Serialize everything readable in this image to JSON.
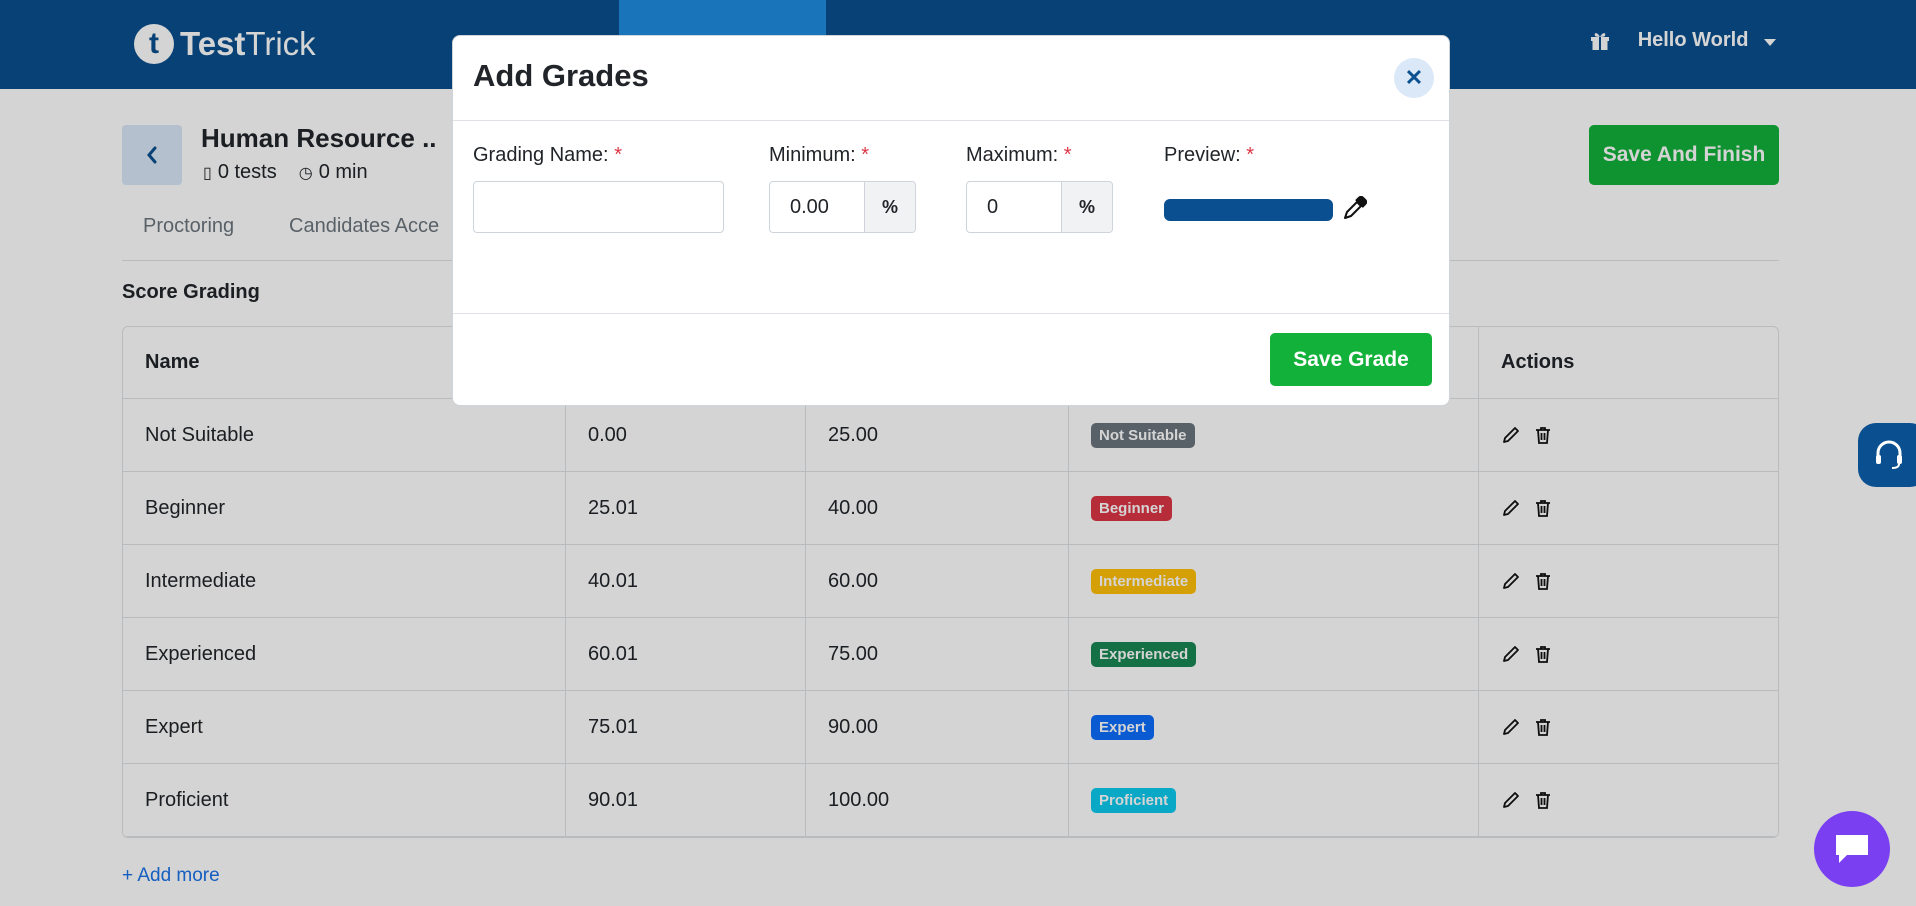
{
  "header": {
    "logo_letter": "t",
    "logo_bold": "Test",
    "logo_regular": "Trick",
    "user_name": "Hello World"
  },
  "test": {
    "title": "Human Resource ..",
    "tests": "0 tests",
    "duration": "0 min",
    "save_finish_label": "Save And Finish"
  },
  "tabs": [
    "Proctoring",
    "Candidates Acce"
  ],
  "section_title": "Score Grading",
  "table": {
    "headers": [
      "Name",
      "",
      "",
      "",
      "Actions"
    ],
    "rows": [
      {
        "name": "Not Suitable",
        "min": "0.00",
        "max": "25.00",
        "badge": "Not Suitable",
        "color": "#6c757d"
      },
      {
        "name": "Beginner",
        "min": "25.01",
        "max": "40.00",
        "badge": "Beginner",
        "color": "#dc3545"
      },
      {
        "name": "Intermediate",
        "min": "40.01",
        "max": "60.00",
        "badge": "Intermediate",
        "color": "#ffc107"
      },
      {
        "name": "Experienced",
        "min": "60.01",
        "max": "75.00",
        "badge": "Experienced",
        "color": "#198754"
      },
      {
        "name": "Expert",
        "min": "75.01",
        "max": "90.00",
        "badge": "Expert",
        "color": "#0d6efd"
      },
      {
        "name": "Proficient",
        "min": "90.01",
        "max": "100.00",
        "badge": "Proficient",
        "color": "#0dcaf0"
      }
    ]
  },
  "add_more_label": "+ Add more",
  "modal": {
    "title": "Add Grades",
    "close_symbol": "✕",
    "grading_name_label": "Grading Name:",
    "minimum_label": "Minimum:",
    "maximum_label": "Maximum:",
    "preview_label": "Preview:",
    "required_mark": "*",
    "minimum_value": "0.00",
    "maximum_value": "0",
    "unit_symbol": "%",
    "preview_color": "#0a4f8f",
    "save_label": "Save Grade"
  },
  "colors": {
    "brand": "#0a4f8f",
    "success": "#12b13a",
    "chat": "#7b3ff2"
  }
}
